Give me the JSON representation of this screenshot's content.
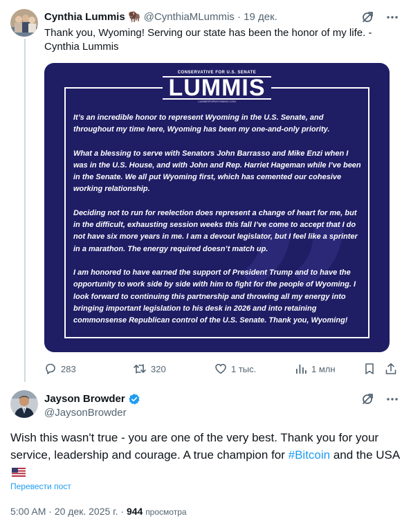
{
  "tweet1": {
    "author_name": "Cynthia Lummis",
    "author_emoji": "🦬",
    "handle": "@CynthiaMLummis",
    "separator": "·",
    "date": "19 дек.",
    "text": "Thank you, Wyoming! Serving our state has been the honor of my life. - Cynthia Lummis",
    "media": {
      "logo_top": "CONSERVATIVE FOR U.S. SENATE",
      "logo_name": "LUMMIS",
      "logo_url": "LUMMISFORWYOMING.COM",
      "paragraphs": [
        "It’s an incredible honor to represent Wyoming in the U.S. Senate, and throughout my time here, Wyoming has been my one-and-only priority.",
        "What a blessing to serve with Senators John Barrasso and Mike Enzi when I was in the U.S. House, and with John and Rep. Harriet Hageman while I’ve been in the Senate. We all put Wyoming first, which has cemented our cohesive working relationship.",
        "Deciding not to run for reelection does represent a change of heart for me, but in the difficult, exhausting session weeks this fall I’ve come to accept that I do not have six more years in me. I am a devout legislator, but I feel like a sprinter in a marathon. The energy required doesn’t match up.",
        "I am honored to have earned the support of President Trump and to have the opportunity to work side by side with him to fight for the people of Wyoming. I look forward to continuing this partnership and throwing all my energy into bringing important legislation to his desk in 2026 and into retaining commonsense Republican control of the U.S. Senate. Thank you, Wyoming!"
      ]
    },
    "stats": {
      "replies": "283",
      "reposts": "320",
      "likes": "1 тыс.",
      "views": "1 млн"
    }
  },
  "reply": {
    "author_name": "Jayson Browder",
    "handle": "@JaysonBrowder",
    "text_before": "Wish this wasn't true - you are one of the very best. Thank you for your service, leadership and courage.  A true champion for ",
    "hashtag": "#Bitcoin",
    "text_after": " and the USA",
    "translate": "Перевести пост",
    "time": "5:00 AM",
    "date": "20 дек. 2025 г.",
    "views_count": "944",
    "views_label": "просмотра",
    "meta_separator": "·"
  },
  "colors": {
    "accent": "#1d9bf0",
    "muted": "#536471",
    "card_bg": "#1f1d64",
    "verified": "#1d9bf0"
  }
}
